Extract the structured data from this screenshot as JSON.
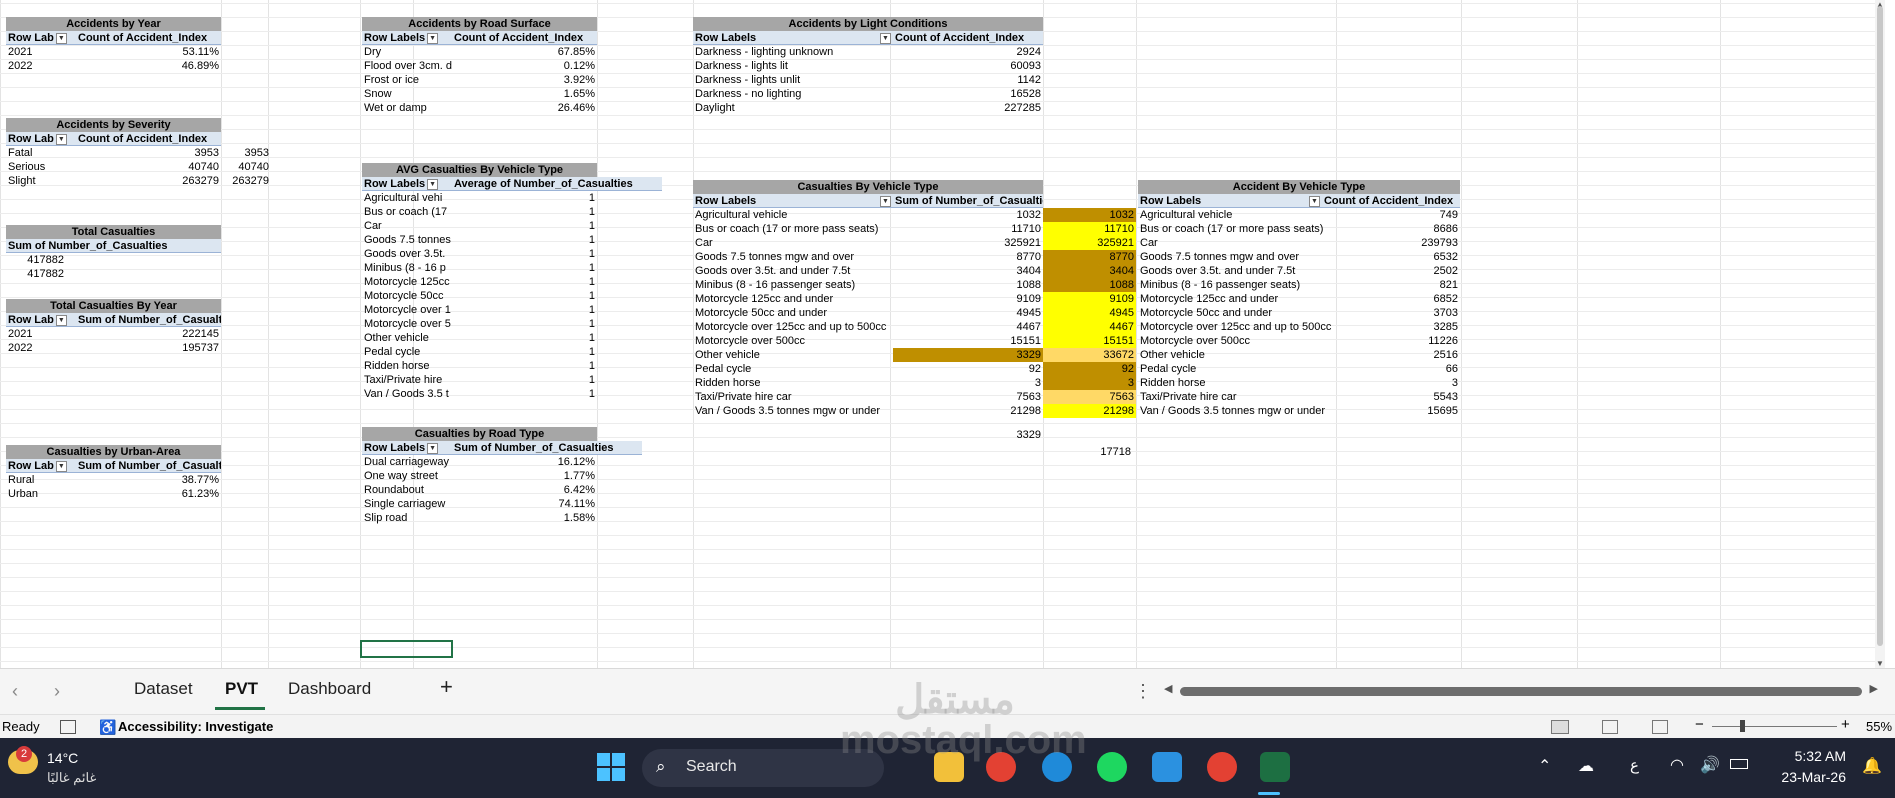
{
  "pivots": {
    "by_year": {
      "title": "Accidents by Year",
      "h1": "Row Lab",
      "h2": "Count of Accident_Index",
      "rows": [
        [
          "2021",
          "53.11%"
        ],
        [
          "2022",
          "46.89%"
        ]
      ]
    },
    "severity": {
      "title": "Accidents by Severity",
      "h1": "Row Lab",
      "h2": "Count of Accident_Index",
      "rows": [
        [
          "Fatal",
          "3953",
          "3953"
        ],
        [
          "Serious",
          "40740",
          "40740"
        ],
        [
          "Slight",
          "263279",
          "263279"
        ]
      ]
    },
    "total_cas": {
      "title": "Total Casualties",
      "h1": "Sum of Number_of_Casualties",
      "rows": [
        "417882",
        "417882"
      ]
    },
    "cas_year": {
      "title": "Total Casualties By Year",
      "h1": "Row Lab",
      "h2": "Sum of Number_of_Casualties",
      "rows": [
        [
          "2021",
          "222145"
        ],
        [
          "2022",
          "195737"
        ]
      ]
    },
    "urban": {
      "title": "Casualties by Urban-Area",
      "h1": "Row Lab",
      "h2": "Sum of Number_of_Casualties",
      "rows": [
        [
          "Rural",
          "38.77%"
        ],
        [
          "Urban",
          "61.23%"
        ]
      ]
    },
    "road_surface": {
      "title": "Accidents by Road Surface",
      "h1": "Row Labels",
      "h2": "Count of Accident_Index",
      "rows": [
        [
          "Dry",
          "67.85%"
        ],
        [
          "Flood over 3cm. d",
          "0.12%"
        ],
        [
          "Frost or ice",
          "3.92%"
        ],
        [
          "Snow",
          "1.65%"
        ],
        [
          "Wet or damp",
          "26.46%"
        ]
      ]
    },
    "avg_veh": {
      "title": "AVG Casualties By Vehicle Type",
      "h1": "Row Labels",
      "h2": "Average of Number_of_Casualties",
      "rows": [
        [
          "Agricultural vehi",
          "1"
        ],
        [
          "Bus or coach (17",
          "1"
        ],
        [
          "Car",
          "1"
        ],
        [
          "Goods 7.5 tonnes",
          "1"
        ],
        [
          "Goods over 3.5t.",
          "1"
        ],
        [
          "Minibus (8 - 16 p",
          "1"
        ],
        [
          "Motorcycle 125cc",
          "1"
        ],
        [
          "Motorcycle 50cc",
          "1"
        ],
        [
          "Motorcycle over 1",
          "1"
        ],
        [
          "Motorcycle over 5",
          "1"
        ],
        [
          "Other vehicle",
          "1"
        ],
        [
          "Pedal cycle",
          "1"
        ],
        [
          "Ridden horse",
          "1"
        ],
        [
          "Taxi/Private hire",
          "1"
        ],
        [
          "Van / Goods 3.5 t",
          "1"
        ]
      ]
    },
    "road_type": {
      "title": "Casualties by Road Type",
      "h1": "Row Labels",
      "h2": "Sum of Number_of_Casualties",
      "rows": [
        [
          "Dual carriageway",
          "16.12%"
        ],
        [
          "One way street",
          "1.77%"
        ],
        [
          "Roundabout",
          "6.42%"
        ],
        [
          "Single carriagew",
          "74.11%"
        ],
        [
          "Slip road",
          "1.58%"
        ]
      ]
    },
    "light": {
      "title": "Accidents by Light Conditions",
      "h1": "Row Labels",
      "h2": "Count of Accident_Index",
      "rows": [
        [
          "Darkness - lighting unknown",
          "2924"
        ],
        [
          "Darkness - lights lit",
          "60093"
        ],
        [
          "Darkness - lights unlit",
          "1142"
        ],
        [
          "Darkness - no lighting",
          "16528"
        ],
        [
          "Daylight",
          "227285"
        ]
      ]
    },
    "cas_veh": {
      "title": "Casualties By Vehicle Type",
      "h1": "Row Labels",
      "h2": "Sum of Number_of_Casualties",
      "rows": [
        [
          "Agricultural vehicle",
          "1032",
          "1032",
          "gold"
        ],
        [
          "Bus or coach (17 or more pass seats)",
          "11710",
          "11710",
          "yel"
        ],
        [
          "Car",
          "325921",
          "325921",
          "yel"
        ],
        [
          "Goods 7.5 tonnes mgw and over",
          "8770",
          "8770",
          "gold"
        ],
        [
          "Goods over 3.5t. and under 7.5t",
          "3404",
          "3404",
          "gold"
        ],
        [
          "Minibus (8 - 16 passenger seats)",
          "1088",
          "1088",
          "gold"
        ],
        [
          "Motorcycle 125cc and under",
          "9109",
          "9109",
          "yel"
        ],
        [
          "Motorcycle 50cc and under",
          "4945",
          "4945",
          "yel"
        ],
        [
          "Motorcycle over 125cc and up to 500cc",
          "4467",
          "4467",
          "yel"
        ],
        [
          "Motorcycle over 500cc",
          "15151",
          "15151",
          "yel"
        ],
        [
          "Other vehicle",
          "3329",
          "33672",
          "lgold"
        ],
        [
          "Pedal cycle",
          "92",
          "92",
          "gold"
        ],
        [
          "Ridden horse",
          "3",
          "3",
          "gold"
        ],
        [
          "Taxi/Private hire car",
          "7563",
          "7563",
          "lgold"
        ],
        [
          "Van / Goods 3.5 tonnes mgw or under",
          "21298",
          "21298",
          "yel"
        ]
      ],
      "below_a": "3329",
      "below_b": "17718"
    },
    "acc_veh": {
      "title": "Accident By Vehicle Type",
      "h1": "Row Labels",
      "h2": "Count of Accident_Index",
      "rows": [
        [
          "Agricultural vehicle",
          "749"
        ],
        [
          "Bus or coach (17 or more pass seats)",
          "8686"
        ],
        [
          "Car",
          "239793"
        ],
        [
          "Goods 7.5 tonnes mgw and over",
          "6532"
        ],
        [
          "Goods over 3.5t. and under 7.5t",
          "2502"
        ],
        [
          "Minibus (8 - 16 passenger seats)",
          "821"
        ],
        [
          "Motorcycle 125cc and under",
          "6852"
        ],
        [
          "Motorcycle 50cc and under",
          "3703"
        ],
        [
          "Motorcycle over 125cc and up to 500cc",
          "3285"
        ],
        [
          "Motorcycle over 500cc",
          "11226"
        ],
        [
          "Other vehicle",
          "2516"
        ],
        [
          "Pedal cycle",
          "66"
        ],
        [
          "Ridden horse",
          "3"
        ],
        [
          "Taxi/Private hire car",
          "5543"
        ],
        [
          "Van / Goods 3.5 tonnes mgw or under",
          "15695"
        ]
      ]
    }
  },
  "tabs": [
    {
      "label": "Dataset"
    },
    {
      "label": "PVT"
    },
    {
      "label": "Dashboard"
    }
  ],
  "add_sheet": "+",
  "status": {
    "ready": "Ready",
    "accessibility": "Accessibility: Investigate",
    "zoom": "55%"
  },
  "taskbar": {
    "temp": "14°C",
    "weather": "غائم غالبًا",
    "badge": "2",
    "search": "Search",
    "lang": "ع",
    "time": "5:32 AM",
    "date": "23-Mar-26"
  },
  "watermark": "مستقل mostaql.com",
  "colors": {
    "gold": "#bf8f00",
    "yellow": "#ffff00",
    "light_gold": "#ffd966",
    "pivot_header": "#dce6f1",
    "pivot_title": "#a6a6a6",
    "excel_green": "#217346"
  }
}
